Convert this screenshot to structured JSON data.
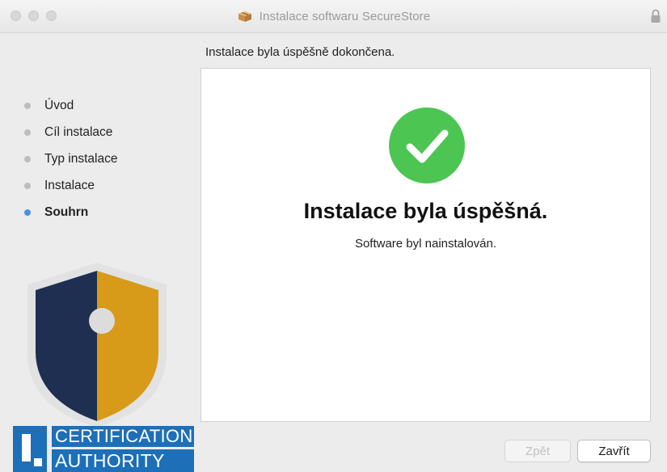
{
  "window": {
    "title": "Instalace softwaru SecureStore",
    "app_icon": "package-icon",
    "lock_icon": "lock-icon"
  },
  "header": {
    "status_text": "Instalace byla úspěšně dokončena."
  },
  "sidebar": {
    "steps": [
      {
        "label": "Úvod",
        "active": false
      },
      {
        "label": "Cíl instalace",
        "active": false
      },
      {
        "label": "Typ instalace",
        "active": false
      },
      {
        "label": "Instalace",
        "active": false
      },
      {
        "label": "Souhrn",
        "active": true
      }
    ],
    "cert_logo": {
      "line1": "CERTIFICATION",
      "line2": "AUTHORITY"
    }
  },
  "content": {
    "icon": "checkmark-circle-icon",
    "title": "Instalace byla úspěšná.",
    "subtitle": "Software byl nainstalován."
  },
  "buttons": {
    "back_label": "Zpět",
    "close_label": "Zavřít",
    "back_enabled": false
  },
  "colors": {
    "success_green": "#4cc552",
    "active_step_blue": "#4a90e2",
    "shield_navy": "#1f2f52",
    "shield_gold": "#d79a19",
    "logo_blue": "#1d6fb8"
  }
}
